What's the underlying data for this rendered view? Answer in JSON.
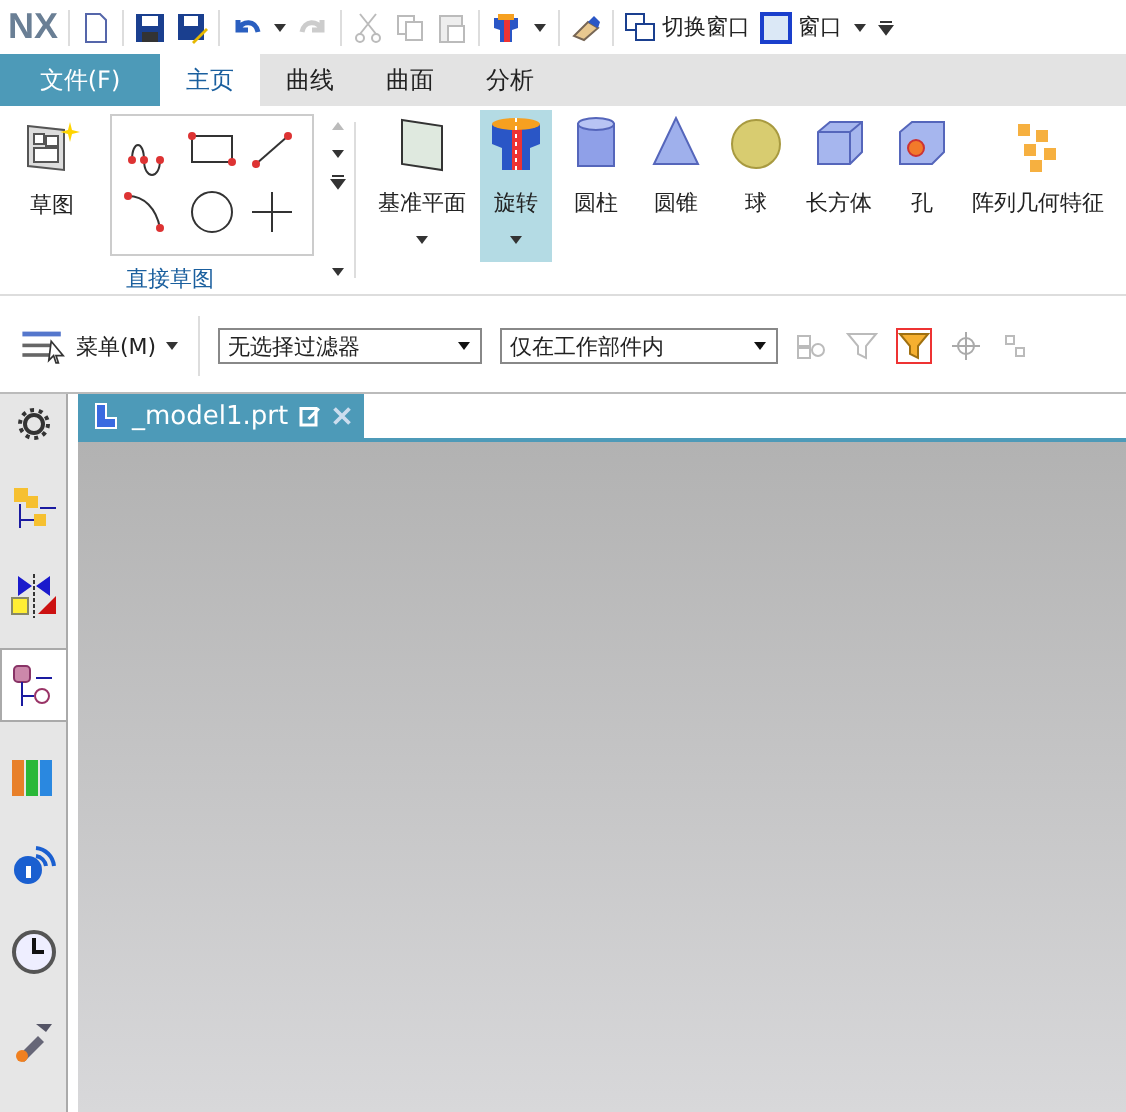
{
  "app": {
    "logo": "NX"
  },
  "quick_access": {
    "switch_window": "切换窗口",
    "window": "窗口"
  },
  "tabs": [
    {
      "label": "文件(F)",
      "kind": "file",
      "selected": false
    },
    {
      "label": "主页",
      "kind": "tab",
      "selected": true
    },
    {
      "label": "曲线",
      "kind": "tab",
      "selected": false
    },
    {
      "label": "曲面",
      "kind": "tab",
      "selected": false
    },
    {
      "label": "分析",
      "kind": "tab",
      "selected": false
    }
  ],
  "ribbon": {
    "sketch": "草图",
    "group_label": "直接草图",
    "tools": [
      {
        "label": "基准平面",
        "dropdown": true,
        "selected": false
      },
      {
        "label": "旋转",
        "dropdown": true,
        "selected": true
      },
      {
        "label": "圆柱",
        "dropdown": false,
        "selected": false
      },
      {
        "label": "圆锥",
        "dropdown": false,
        "selected": false
      },
      {
        "label": "球",
        "dropdown": false,
        "selected": false
      },
      {
        "label": "长方体",
        "dropdown": false,
        "selected": false
      },
      {
        "label": "孔",
        "dropdown": false,
        "selected": false
      },
      {
        "label": "阵列几何特征",
        "dropdown": false,
        "selected": false
      }
    ]
  },
  "toolbar": {
    "menu": "菜单(M)",
    "filter": "无选择过滤器",
    "scope": "仅在工作部件内"
  },
  "document_tab": {
    "title": "_model1.prt"
  },
  "sidebar": [
    {
      "selected": false
    },
    {
      "selected": false
    },
    {
      "selected": true
    },
    {
      "selected": false
    },
    {
      "selected": false
    },
    {
      "selected": false
    },
    {
      "selected": false
    }
  ]
}
